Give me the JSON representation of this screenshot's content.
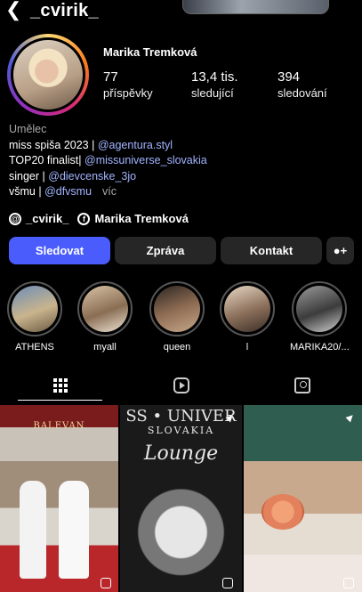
{
  "header": {
    "back_label": "‹",
    "username": "_cvirik_"
  },
  "profile": {
    "full_name": "Marika Tremková",
    "stats": [
      {
        "value": "77",
        "label": "příspěvky"
      },
      {
        "value": "13,4 tis.",
        "label": "sledující"
      },
      {
        "value": "394",
        "label": "sledování"
      }
    ]
  },
  "bio": {
    "category": "Umělec",
    "line1_text": "miss spiša  2023 | ",
    "line1_mention": "@agentura.styl",
    "line2_text": "TOP20 finalist| ",
    "line2_mention": "@missuniverse_slovakia",
    "line3_text": "singer | ",
    "line3_mention": "@dievcenske_3jo",
    "line4_text": "všmu | ",
    "line4_mention": "@dfvsmu",
    "more": "víc"
  },
  "links": {
    "threads": "_cvirik_",
    "facebook": "Marika Tremková"
  },
  "buttons": {
    "follow": "Sledovat",
    "message": "Zpráva",
    "contact": "Kontakt",
    "add_person": "+"
  },
  "highlights": [
    {
      "label": "ATHENS"
    },
    {
      "label": "myall"
    },
    {
      "label": "queen"
    },
    {
      "label": "l"
    },
    {
      "label": "MARIKA20/..."
    }
  ],
  "tabs": {
    "active": "posts"
  },
  "posts": [
    {
      "caption": "BALEVAN"
    },
    {
      "caption_top": "SS • UNIVER",
      "caption_mid": "SLOVAKIA",
      "caption_script": "Lounge"
    },
    {
      "caption": ""
    }
  ],
  "colors": {
    "accent": "#4a5dfc",
    "mention": "#a2b4ff",
    "button": "#262626"
  }
}
